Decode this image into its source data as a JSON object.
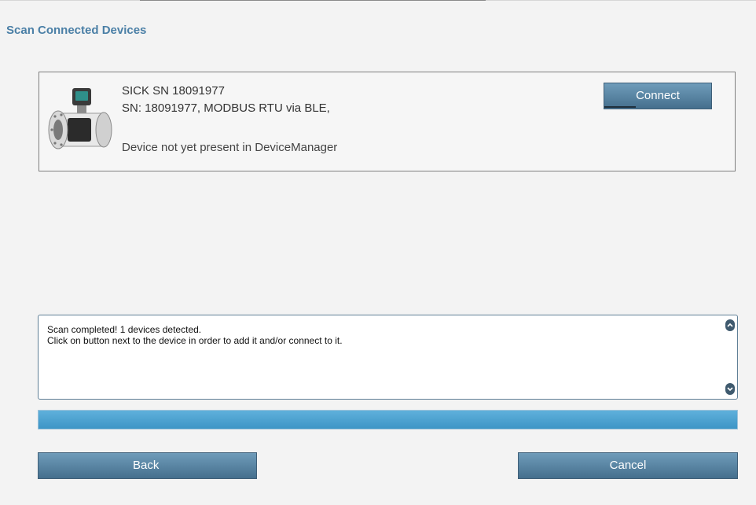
{
  "page": {
    "title": "Scan Connected Devices"
  },
  "device": {
    "name": "SICK SN 18091977",
    "sn_line": "SN: 18091977, MODBUS RTU via BLE,",
    "status": "Device not yet present in DeviceManager",
    "image_icon": "flowmeter-device-icon",
    "connect_label": "Connect"
  },
  "log": {
    "lines": [
      "Scan completed! 1 devices detected.",
      "Click on button next to the device in order to add it and/or connect to it."
    ]
  },
  "progress": {
    "fraction": 1.0
  },
  "footer": {
    "back_label": "Back",
    "cancel_label": "Cancel"
  },
  "colors": {
    "title": "#4a7fa6",
    "button": "#5a86a5",
    "progress": "#4aa2d1"
  }
}
